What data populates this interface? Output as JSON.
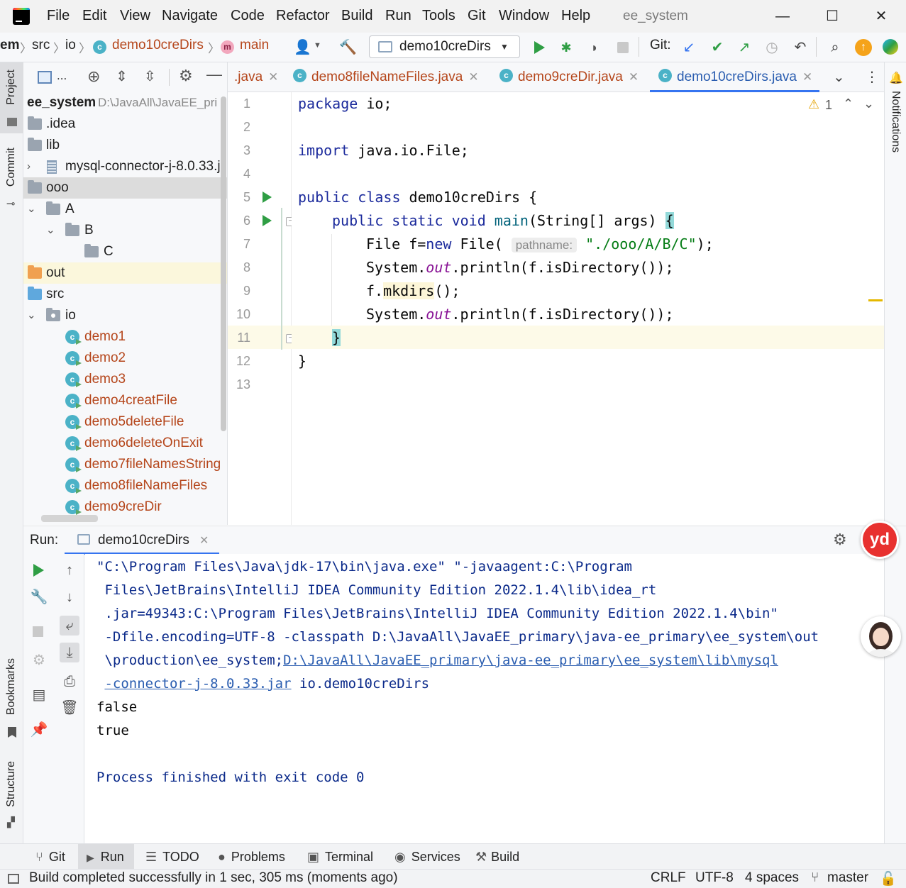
{
  "titlebar": {
    "menu": [
      "File",
      "Edit",
      "View",
      "Navigate",
      "Code",
      "Refactor",
      "Build",
      "Run",
      "Tools",
      "Git",
      "Window",
      "Help"
    ],
    "window_title": "ee_system",
    "minimize": "—",
    "maximize": "☐",
    "close": "✕"
  },
  "navbar": {
    "crumbs": [
      "em",
      "src",
      "io",
      "demo10creDirs",
      "main"
    ],
    "class_icon": "c",
    "method_icon": "m",
    "run_config": "demo10creDirs",
    "git_label": "Git:"
  },
  "left_stripe": {
    "project": "Project",
    "commit": "Commit",
    "bookmarks": "Bookmarks",
    "structure": "Structure"
  },
  "project_tree": {
    "toolbar_label": "...",
    "root_name": "ee_system",
    "root_path": "D:\\JavaAll\\JavaEE_pri",
    "items": [
      {
        "label": ".idea"
      },
      {
        "label": "lib"
      },
      {
        "label": "mysql-connector-j-8.0.33.j"
      },
      {
        "label": "ooo"
      },
      {
        "label": "A"
      },
      {
        "label": "B"
      },
      {
        "label": "C"
      },
      {
        "label": "out"
      },
      {
        "label": "src"
      },
      {
        "label": "io"
      },
      {
        "label": "demo1"
      },
      {
        "label": "demo2"
      },
      {
        "label": "demo3"
      },
      {
        "label": "demo4creatFile"
      },
      {
        "label": "demo5deleteFile"
      },
      {
        "label": "demo6deleteOnExit"
      },
      {
        "label": "demo7fileNamesString"
      },
      {
        "label": "demo8fileNameFiles"
      },
      {
        "label": "demo9creDir"
      }
    ]
  },
  "editor_tabs": [
    {
      "label": ".java"
    },
    {
      "label": "demo8fileNameFiles.java"
    },
    {
      "label": "demo9creDir.java"
    },
    {
      "label": "demo10creDirs.java",
      "active": true
    }
  ],
  "editor": {
    "line_numbers": [
      "1",
      "2",
      "3",
      "4",
      "5",
      "6",
      "7",
      "8",
      "9",
      "10",
      "11",
      "12",
      "13"
    ],
    "warning_count": "1",
    "code": {
      "l1_kw": "package",
      "l1_rest": " io;",
      "l3_kw": "import",
      "l3_rest": " java.io.File;",
      "l5_kw": "public class",
      "l5_rest": " demo10creDirs {",
      "l6_kw": "public static void",
      "l6_fn": "main",
      "l6_rest": "(String[] args) ",
      "l6_brace": "{",
      "l7_a": "File f=",
      "l7_kw": "new",
      "l7_b": " File(",
      "l7_hint": "pathname:",
      "l7_str": "\"./ooo/A/B/C\"",
      "l7_c": ");",
      "l8_a": "System.",
      "l8_st": "out",
      "l8_b": ".println(f.isDirectory());",
      "l9_a": "f.",
      "l9_mk": "mkdirs",
      "l9_b": "();",
      "l10_a": "System.",
      "l10_st": "out",
      "l10_b": ".println(f.isDirectory());",
      "l11": "}",
      "l12": "}"
    }
  },
  "right_stripe": {
    "notifications": "Notifications"
  },
  "run_panel": {
    "label": "Run:",
    "tab": "demo10creDirs",
    "console": {
      "cmd1": "\"C:\\Program Files\\Java\\jdk-17\\bin\\java.exe\" \"-javaagent:C:\\Program",
      "cmd2": " Files\\JetBrains\\IntelliJ IDEA Community Edition 2022.1.4\\lib\\idea_rt",
      "cmd3": " .jar=49343:C:\\Program Files\\JetBrains\\IntelliJ IDEA Community Edition 2022.1.4\\bin\"",
      "cmd4": " -Dfile.encoding=UTF-8 -classpath D:\\JavaAll\\JavaEE_primary\\java-ee_primary\\ee_system\\out",
      "cmd5_a": " \\production\\ee_system;",
      "cmd5_link": "D:\\JavaAll\\JavaEE_primary\\java-ee_primary\\ee_system\\lib\\mysql",
      "cmd6_link": "-connector-j-8.0.33.jar",
      "cmd6_b": " io.demo10creDirs",
      "out1": "false",
      "out2": "true",
      "exit": "Process finished with exit code 0"
    }
  },
  "bottom_tools": [
    "Git",
    "Run",
    "TODO",
    "Problems",
    "Terminal",
    "Services",
    "Build"
  ],
  "statusbar": {
    "message": "Build completed successfully in 1 sec, 305 ms (moments ago)",
    "line_sep": "CRLF",
    "encoding": "UTF-8",
    "indent": "4 spaces",
    "branch": "master"
  },
  "badges": {
    "yd": "yd"
  },
  "colors": {
    "accent": "#3574f0",
    "run_green": "#2f9e44",
    "keyword": "#1b2a9c",
    "string": "#067d17",
    "class_file": "#b5461b"
  }
}
